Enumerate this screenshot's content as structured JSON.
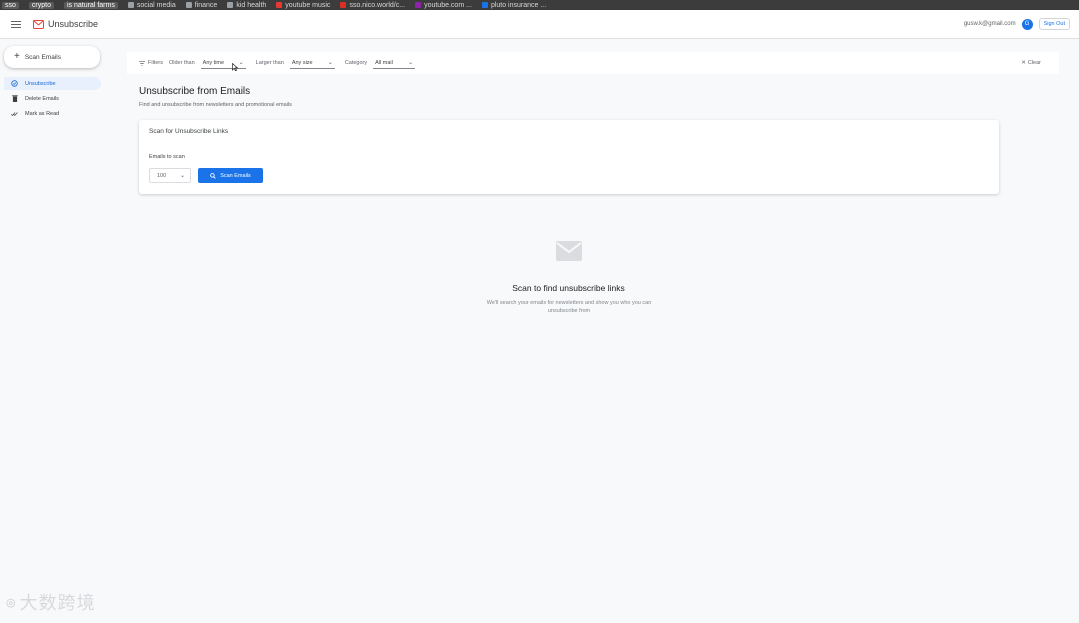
{
  "bookmarks": [
    {
      "label": "sso",
      "style": "pill"
    },
    {
      "label": "crypto",
      "style": "pill"
    },
    {
      "label": "is natural farms",
      "style": "pill"
    },
    {
      "label": "social media",
      "color": "#9aa0a6"
    },
    {
      "label": "finance",
      "color": "#9aa0a6"
    },
    {
      "label": "kid health",
      "color": "#9aa0a6"
    },
    {
      "label": "youtube music",
      "color": "#e53935"
    },
    {
      "label": "sso.nico.world/c...",
      "color": "#d93025"
    },
    {
      "label": "youtube.com ...",
      "color": "#8e24aa"
    },
    {
      "label": "pluto insurance ...",
      "color": "#1a73e8"
    }
  ],
  "header": {
    "title": "Unsubscribe",
    "user_email": "gusw.k@gmail.com",
    "avatar_letter": "G",
    "sign_out": "Sign Out"
  },
  "sidebar": {
    "scan_button": "Scan Emails",
    "items": [
      {
        "label": "Unsubscribe",
        "icon": "unsubscribe-icon",
        "active": true
      },
      {
        "label": "Delete Emails",
        "icon": "trash-icon",
        "active": false
      },
      {
        "label": "Mark as Read",
        "icon": "check-icon",
        "active": false
      }
    ]
  },
  "filters": {
    "label": "Filters",
    "older_than_label": "Older than",
    "older_than_value": "Any time",
    "larger_than_label": "Larger than",
    "larger_than_value": "Any size",
    "category_label": "Category",
    "category_value": "All mail",
    "clear": "Clear"
  },
  "main": {
    "title": "Unsubscribe from Emails",
    "subtitle": "Find and unsubscribe from newsletters and promotional emails",
    "card_title": "Scan for Unsubscribe Links",
    "emails_to_scan_label": "Emails to scan",
    "emails_to_scan_value": "100",
    "scan_button": "Scan Emails"
  },
  "empty_state": {
    "title": "Scan to find unsubscribe links",
    "description": "We'll search your emails for newsletters and show you who you can unsubscribe from"
  },
  "colors": {
    "accent": "#1a73e8",
    "active_nav_bg": "#e8f0fe"
  },
  "watermark": {
    "text": "大数跨境"
  }
}
